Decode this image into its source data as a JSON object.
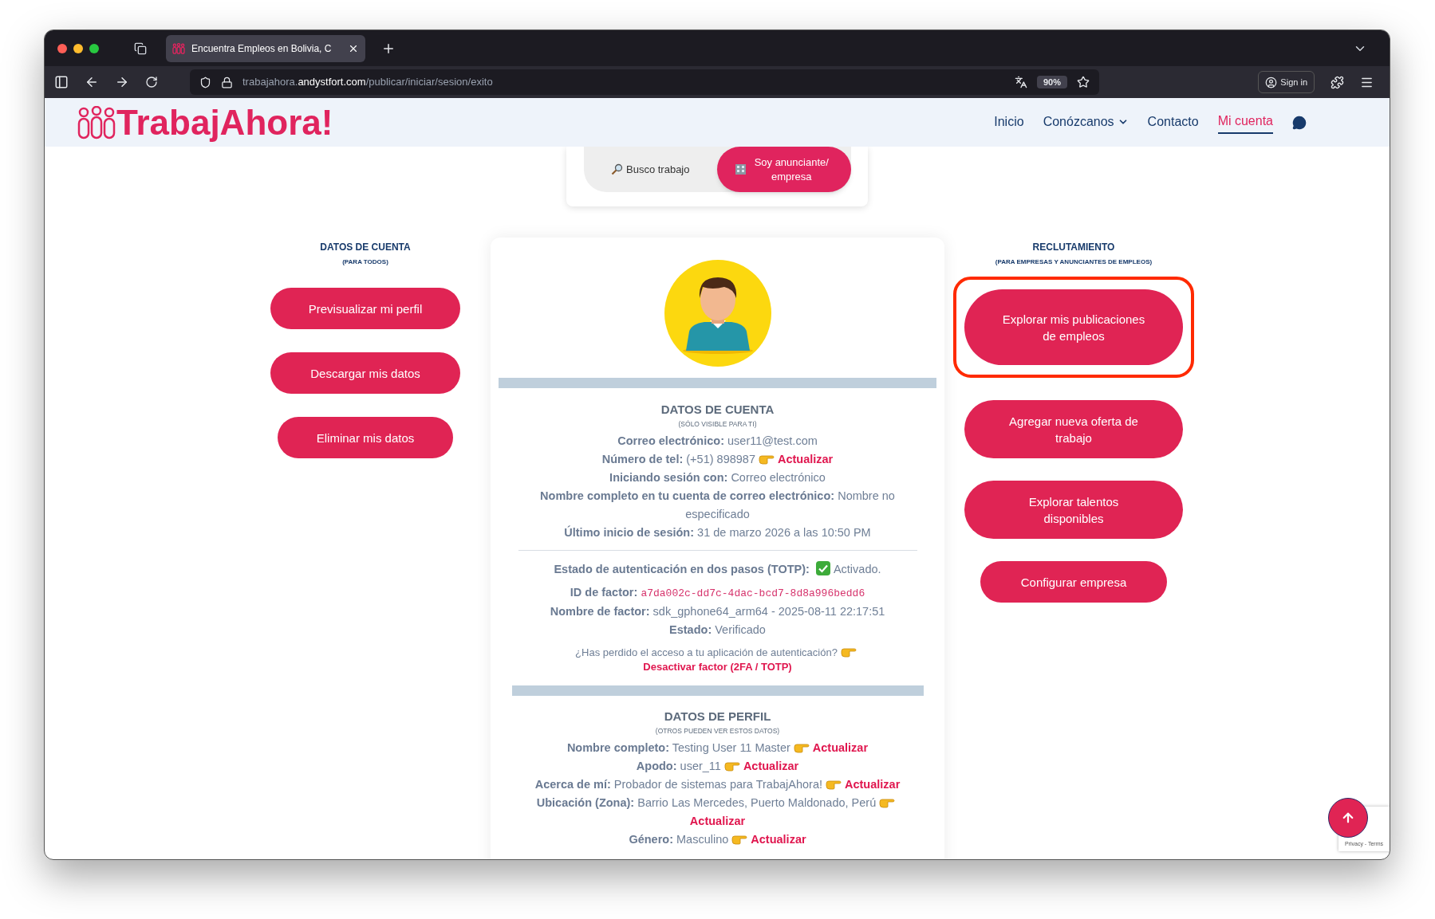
{
  "browser": {
    "tab_title": "Encuentra Empleos en Bolivia, C",
    "url_prefix": "trabajahora.",
    "url_domain": "andystfort.com",
    "url_path": "/publicar/iniciar/sesion/exito",
    "zoom": "90%",
    "sign_in": "Sign in"
  },
  "header": {
    "logo": "TrabajAhora!",
    "nav": [
      {
        "label": "Inicio",
        "kind": "link",
        "selected": false
      },
      {
        "label": "Conózcanos",
        "kind": "dropdown",
        "selected": false
      },
      {
        "label": "Contacto",
        "kind": "link",
        "selected": false
      },
      {
        "label": "Mi cuenta",
        "kind": "link",
        "selected": true
      }
    ]
  },
  "role_toggle": [
    {
      "label": "Busco trabajo",
      "kind": "search",
      "selected": false
    },
    {
      "label": "Soy anunciante/ empresa",
      "kind": "building",
      "selected": true
    }
  ],
  "left": {
    "title": "DATOS DE CUENTA",
    "subtitle": "(PARA TODOS)",
    "buttons": [
      "Previsualizar mi perfil",
      "Descargar mis datos",
      "Eliminar mis datos"
    ]
  },
  "account": {
    "title": "DATOS DE CUENTA",
    "subtitle": "(SÓLO VISIBLE PARA TI)",
    "rows": [
      {
        "kind": "plain",
        "label": "Correo electrónico:",
        "value": "user11@test.com"
      },
      {
        "kind": "plain",
        "label": "Número de tel:",
        "value": "(+51) 898987",
        "action": "Actualizar"
      },
      {
        "kind": "plain",
        "label": "Iniciando sesión con:",
        "value": "Correo electrónico"
      },
      {
        "kind": "plain",
        "label": "Nombre completo en tu cuenta de correo electrónico:",
        "value": "Nombre no especificado"
      },
      {
        "kind": "plain",
        "label": "Último inicio de sesión:",
        "value": "31 de marzo 2026 a las 10:50 PM"
      }
    ]
  },
  "two_factor": {
    "rows": [
      {
        "kind": "status",
        "label": "Estado de autenticación en dos pasos (TOTP):",
        "value": "Activado."
      },
      {
        "kind": "code",
        "label": "ID de factor:",
        "value": "a7da002c-dd7c-4dac-bcd7-8d8a996bedd6"
      },
      {
        "kind": "plain",
        "label": "Nombre de factor:",
        "value": "sdk_gphone64_arm64 - 2025-08-11 22:17:51"
      },
      {
        "kind": "plain",
        "label": "Estado:",
        "value": "Verificado"
      },
      {
        "kind": "note",
        "value": "¿Has perdido el acceso a tu aplicación de autenticación?",
        "action": "Desactivar factor (2FA / TOTP)"
      }
    ]
  },
  "profile": {
    "title": "DATOS DE PERFIL",
    "subtitle": "(OTROS PUEDEN VER ESTOS DATOS)",
    "rows": [
      {
        "kind": "plain",
        "label": "Nombre completo:",
        "value": "Testing User 11 Master",
        "action": "Actualizar"
      },
      {
        "kind": "plain",
        "label": "Apodo:",
        "value": "user_11",
        "action": "Actualizar"
      },
      {
        "kind": "plain",
        "label": "Acerca de mí:",
        "value": "Probador de sistemas para TrabajAhora!",
        "action": "Actualizar"
      },
      {
        "kind": "plain",
        "label": "Ubicación (Zona):",
        "value": "Barrio Las Mercedes, Puerto Maldonado, Perú",
        "action": "Actualizar"
      },
      {
        "kind": "plain",
        "label": "Género:",
        "value": "Masculino",
        "action": "Actualizar"
      }
    ]
  },
  "right": {
    "title": "RECLUTAMIENTO",
    "subtitle": "(PARA EMPRESAS Y ANUNCIANTES DE EMPLEOS)",
    "buttons": [
      {
        "label": "Explorar mis publicaciones de empleos",
        "highlighted": true
      },
      {
        "label": "Agregar nueva oferta de trabajo",
        "highlighted": false
      },
      {
        "label": "Explorar talentos disponibles",
        "highlighted": false
      },
      {
        "label": "Configurar empresa",
        "highlighted": false
      }
    ]
  },
  "recaptcha": "Privacy - Terms"
}
